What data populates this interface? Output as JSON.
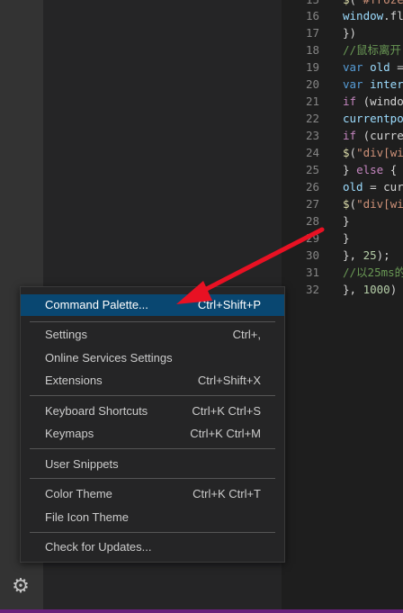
{
  "editor": {
    "lines": [
      {
        "n": "16",
        "parts": [
          [
            "var",
            "window"
          ],
          [
            "punc",
            ".fl"
          ]
        ]
      },
      {
        "n": "17",
        "parts": [
          [
            "punc",
            "})"
          ]
        ]
      },
      {
        "n": "18",
        "parts": [
          [
            "cmt",
            "//鼠标离开"
          ]
        ]
      },
      {
        "n": "19",
        "parts": [
          [
            "kw2",
            "var "
          ],
          [
            "var",
            "old"
          ],
          [
            "punc",
            " ="
          ]
        ]
      },
      {
        "n": "20",
        "parts": [
          [
            "kw2",
            "var "
          ],
          [
            "var",
            "inter"
          ]
        ]
      },
      {
        "n": "21",
        "parts": [
          [
            "kw",
            "if "
          ],
          [
            "punc",
            "(windo"
          ]
        ]
      },
      {
        "n": "22",
        "parts": [
          [
            "var",
            "currentpo"
          ]
        ]
      },
      {
        "n": "23",
        "parts": [
          [
            "kw",
            "if "
          ],
          [
            "punc",
            "(curre"
          ]
        ]
      },
      {
        "n": "24",
        "parts": [
          [
            "fn",
            "$"
          ],
          [
            "punc",
            "("
          ],
          [
            "str",
            "\"div[wi"
          ]
        ]
      },
      {
        "n": "25",
        "parts": [
          [
            "punc",
            "} "
          ],
          [
            "kw",
            "else"
          ],
          [
            "punc",
            " {"
          ]
        ]
      },
      {
        "n": "26",
        "parts": [
          [
            "var",
            "old"
          ],
          [
            "punc",
            " = cur"
          ]
        ]
      },
      {
        "n": "27",
        "parts": [
          [
            "fn",
            "$"
          ],
          [
            "punc",
            "("
          ],
          [
            "str",
            "\"div[wi"
          ]
        ]
      },
      {
        "n": "28",
        "parts": [
          [
            "punc",
            "}"
          ]
        ]
      },
      {
        "n": "29",
        "parts": [
          [
            "punc",
            "}"
          ]
        ]
      },
      {
        "n": "30",
        "parts": [
          [
            "punc",
            "}, "
          ],
          [
            "num",
            "25"
          ],
          [
            "punc",
            ");"
          ]
        ]
      },
      {
        "n": "31",
        "parts": [
          [
            "cmt",
            "//以25ms的"
          ]
        ]
      },
      {
        "n": "32",
        "parts": [
          [
            "punc",
            "}, "
          ],
          [
            "num",
            "1000"
          ],
          [
            "punc",
            ")"
          ]
        ]
      }
    ]
  },
  "menu": {
    "command_palette": {
      "label": "Command Palette...",
      "key": "Ctrl+Shift+P"
    },
    "settings": {
      "label": "Settings",
      "key": "Ctrl+,"
    },
    "online_services": {
      "label": "Online Services Settings",
      "key": ""
    },
    "extensions": {
      "label": "Extensions",
      "key": "Ctrl+Shift+X"
    },
    "keyboard_shortcuts": {
      "label": "Keyboard Shortcuts",
      "key": "Ctrl+K Ctrl+S"
    },
    "keymaps": {
      "label": "Keymaps",
      "key": "Ctrl+K Ctrl+M"
    },
    "user_snippets": {
      "label": "User Snippets",
      "key": ""
    },
    "color_theme": {
      "label": "Color Theme",
      "key": "Ctrl+K Ctrl+T"
    },
    "file_icon_theme": {
      "label": "File Icon Theme",
      "key": ""
    },
    "check_updates": {
      "label": "Check for Updates...",
      "key": ""
    }
  },
  "activity_bar": {
    "manage_icon": "gear-icon"
  },
  "colors": {
    "highlight": "#094771",
    "annotation_arrow": "#e81123",
    "status_bar": "#68217a"
  }
}
